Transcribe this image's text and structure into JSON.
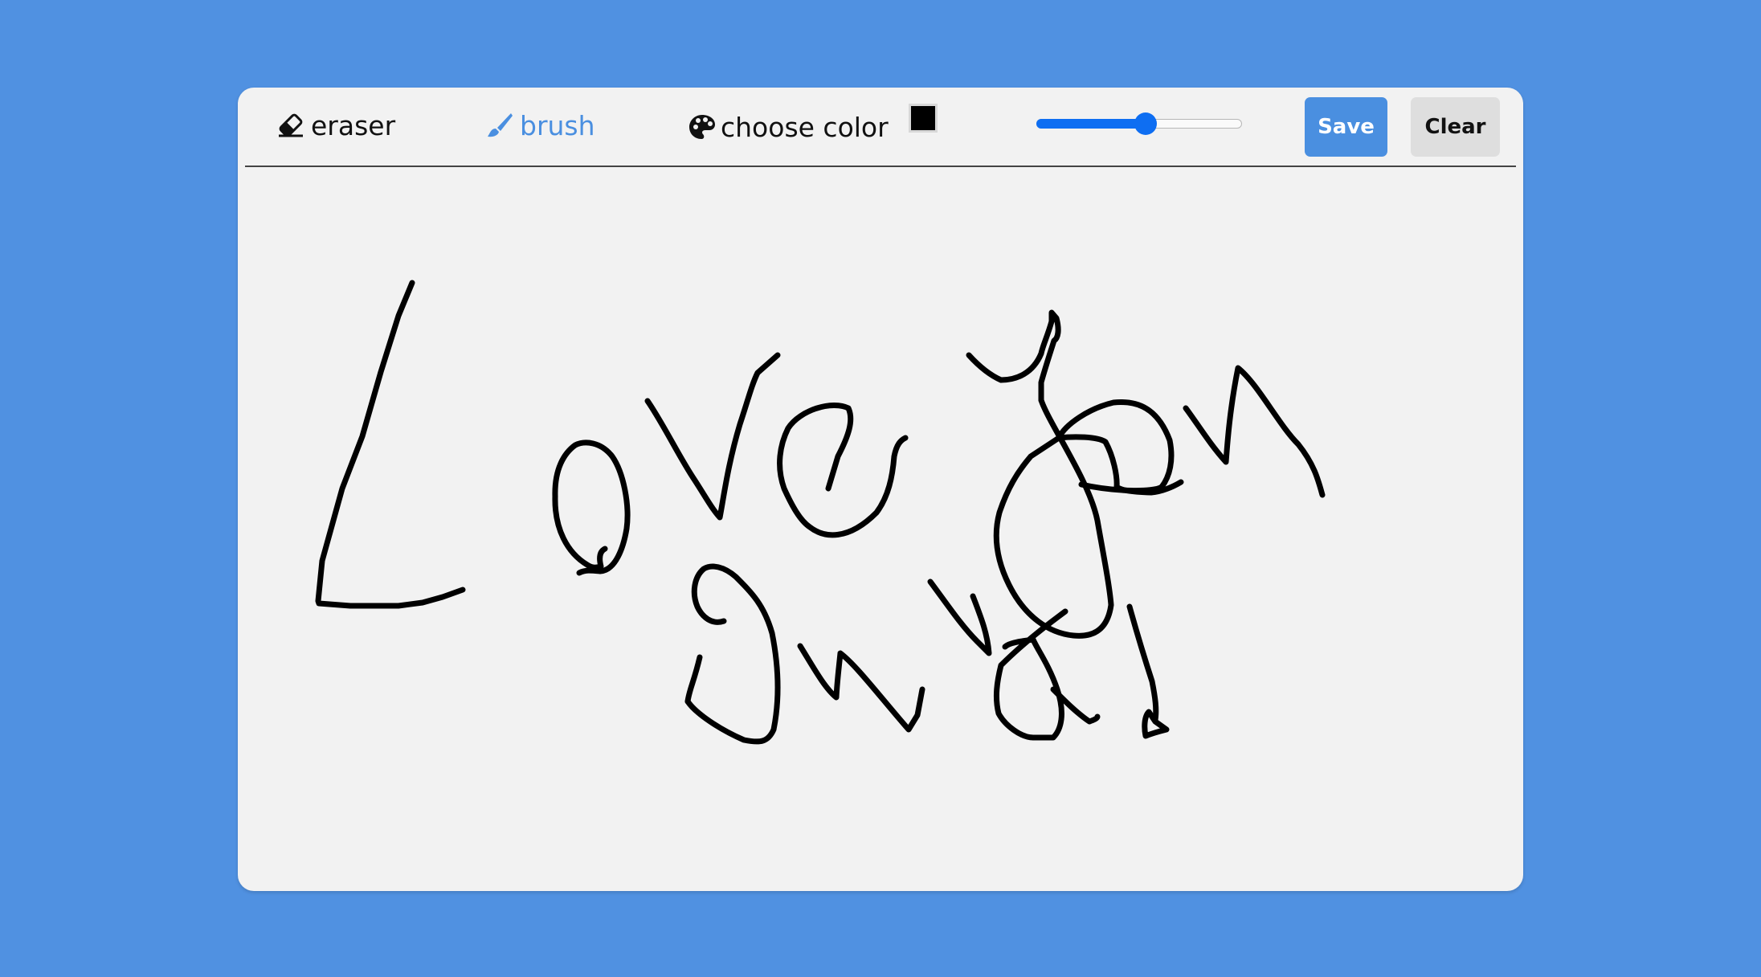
{
  "toolbar": {
    "eraser": {
      "label": "eraser",
      "icon": "eraser-icon"
    },
    "brush": {
      "label": "brush",
      "icon": "paintbrush-icon",
      "active": true
    },
    "color": {
      "label": "choose color",
      "icon": "palette-icon",
      "value": "#000000"
    },
    "brush_size": {
      "fraction": 0.53
    },
    "save_label": "Save",
    "clear_label": "Clear"
  },
  "colors": {
    "background": "#5091e1",
    "canvas": "#f2f2f2",
    "accent": "#4a8fe0",
    "slider": "#0e6ef2",
    "clear_button": "#dedede",
    "stroke": "#000000"
  },
  "canvas": {
    "drawing_description": "handwritten text: Love you only!"
  }
}
